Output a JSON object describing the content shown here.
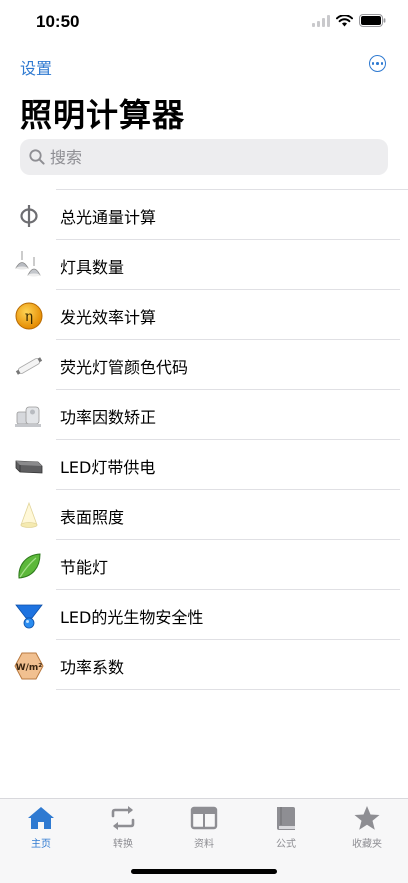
{
  "status_bar": {
    "time": "10:50"
  },
  "nav": {
    "back_label": "设置",
    "more_icon": "ellipsis-circle-icon"
  },
  "page": {
    "title": "照明计算器"
  },
  "search": {
    "placeholder": "搜索"
  },
  "items": [
    {
      "label": "总光通量计算",
      "icon": "phi-symbol-icon"
    },
    {
      "label": "灯具数量",
      "icon": "hanging-lamps-icon"
    },
    {
      "label": "发光效率计算",
      "icon": "eta-coin-icon"
    },
    {
      "label": "荧光灯管颜色代码",
      "icon": "fluorescent-tube-icon"
    },
    {
      "label": "功率因数矫正",
      "icon": "capacitor-icon"
    },
    {
      "label": "LED灯带供电",
      "icon": "power-supply-icon"
    },
    {
      "label": "表面照度",
      "icon": "light-cone-icon"
    },
    {
      "label": "节能灯",
      "icon": "green-leaf-icon"
    },
    {
      "label": "LED的光生物安全性",
      "icon": "blue-drop-icon"
    },
    {
      "label": "功率系数",
      "icon": "wm2-hexagon-icon"
    }
  ],
  "tabs": [
    {
      "label": "主页",
      "icon": "home-icon",
      "active": true
    },
    {
      "label": "转换",
      "icon": "convert-arrows-icon",
      "active": false
    },
    {
      "label": "资料",
      "icon": "browser-window-icon",
      "active": false
    },
    {
      "label": "公式",
      "icon": "book-icon",
      "active": false
    },
    {
      "label": "收藏夹",
      "icon": "star-icon",
      "active": false
    }
  ],
  "colors": {
    "accent": "#2f7ad1",
    "inactive": "#8e8e93",
    "separator": "#e0e0e4"
  }
}
